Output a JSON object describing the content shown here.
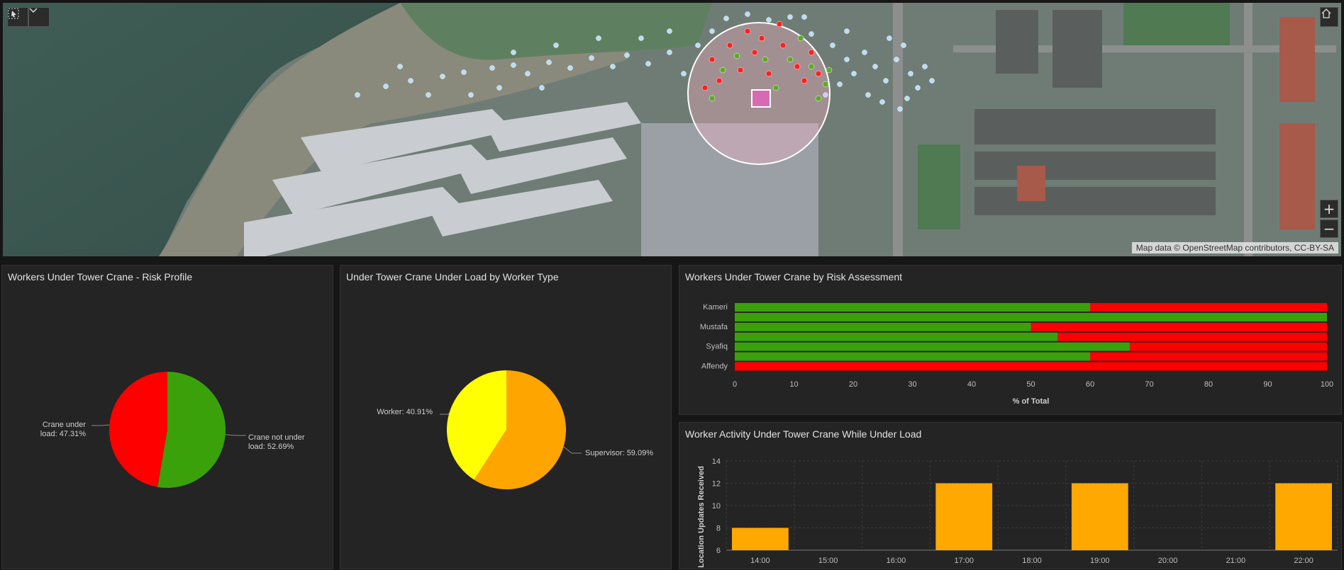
{
  "map": {
    "attribution": "Map data © OpenStreetMap contributors, CC-BY-SA",
    "zoom_in": "+",
    "zoom_out": "−"
  },
  "panels": {
    "risk_profile": {
      "title": "Workers Under Tower Crane - Risk Profile"
    },
    "worker_type": {
      "title": "Under Tower Crane Under Load by Worker Type"
    },
    "risk_assessment": {
      "title": "Workers Under Tower Crane by Risk Assessment"
    },
    "activity": {
      "title": "Worker Activity Under Tower Crane While Under Load"
    }
  },
  "colors": {
    "green": "#3aa10a",
    "red": "#ff0000",
    "yellow": "#ffff00",
    "orange": "#ffa500",
    "bar_orange": "#ffa800"
  },
  "chart_data": [
    {
      "type": "pie",
      "labels": [
        "Crane under load",
        "Crane not under load"
      ],
      "label_text": [
        "Crane under\nload: 47.31%",
        "Crane not under\nload: 52.69%"
      ],
      "values": [
        47.31,
        52.69
      ],
      "colors": [
        "#ff0000",
        "#3aa10a"
      ]
    },
    {
      "type": "pie",
      "labels": [
        "Worker",
        "Supervisor"
      ],
      "label_text": [
        "Worker: 40.91%",
        "Supervisor: 59.09%"
      ],
      "values": [
        40.91,
        59.09
      ],
      "colors": [
        "#ffff00",
        "#ffa500"
      ]
    },
    {
      "type": "bar",
      "orientation": "horizontal",
      "stacked": true,
      "categories": [
        "Kameri",
        "",
        "Mustafa",
        "",
        "Syafiq",
        "",
        "Affendy"
      ],
      "series": [
        {
          "values": [
            60,
            100,
            50,
            54.5,
            66.7,
            60,
            0
          ],
          "color": "#3aa10a"
        },
        {
          "values": [
            40,
            0,
            50,
            45.5,
            33.3,
            40,
            100
          ],
          "color": "#ff0000"
        }
      ],
      "xlabel": "% of Total",
      "xlim": [
        0,
        100
      ],
      "xticks": [
        0,
        10,
        20,
        30,
        40,
        50,
        60,
        70,
        80,
        90,
        100
      ]
    },
    {
      "type": "bar",
      "categories": [
        "14:00",
        "15:00",
        "16:00",
        "17:00",
        "18:00",
        "19:00",
        "20:00",
        "21:00",
        "22:00"
      ],
      "values": [
        8,
        0,
        0,
        12,
        0,
        12,
        0,
        0,
        12
      ],
      "ylabel": "Location Updates Received",
      "ylim": [
        6,
        14
      ],
      "yticks": [
        6,
        8,
        10,
        12,
        14
      ],
      "grid": true
    }
  ]
}
